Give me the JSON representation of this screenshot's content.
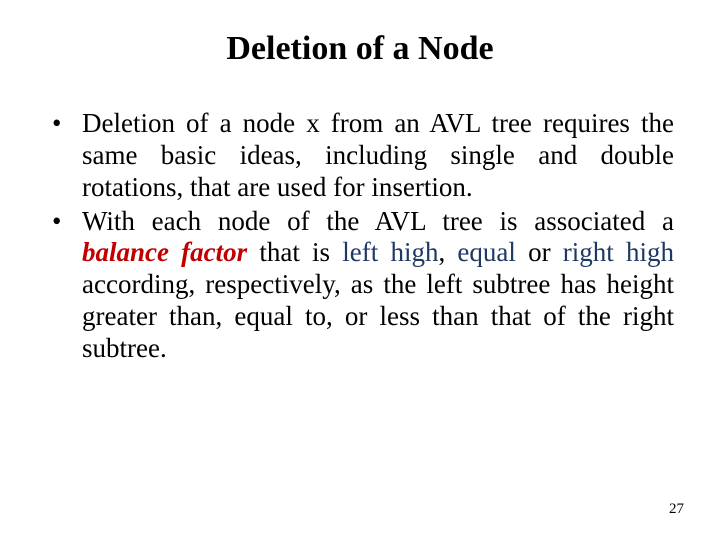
{
  "title": "Deletion of a Node",
  "bullets": [
    {
      "full": "Deletion of a node x from an AVL tree requires the same basic ideas, including single and double rotations, that are used for insertion."
    },
    {
      "part1": "With each node of the AVL tree is associated a ",
      "balance_factor": "balance factor",
      "part2": " that is ",
      "left_high": "left high",
      "part3": ", ",
      "equal": "equal",
      "part4": " or ",
      "right_high": "right high",
      "part5": " according, respectively, as the left subtree has height greater than, equal to, or less than that of the right subtree."
    }
  ],
  "page_number": "27"
}
